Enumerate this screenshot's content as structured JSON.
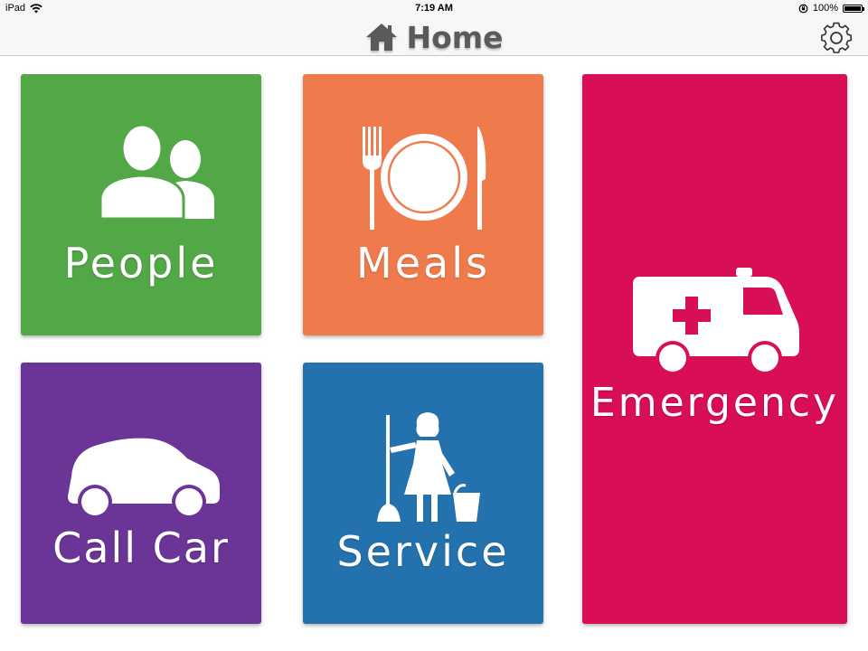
{
  "status_bar": {
    "device": "iPad",
    "time": "7:19 AM",
    "battery": "100%",
    "battery_level": 1.0
  },
  "nav": {
    "title": "Home",
    "title_icon": "home-icon",
    "settings_icon": "gear-icon"
  },
  "tiles": {
    "people": {
      "label": "People",
      "icon": "people-icon",
      "color": "#52a847"
    },
    "meals": {
      "label": "Meals",
      "icon": "plate-icon",
      "color": "#ef7a4c"
    },
    "emergency": {
      "label": "Emergency",
      "icon": "ambulance-icon",
      "color": "#d80e57"
    },
    "call_car": {
      "label": "Call Car",
      "icon": "car-icon",
      "color": "#6b3497"
    },
    "service": {
      "label": "Service",
      "icon": "maid-icon",
      "color": "#2472ad"
    }
  }
}
